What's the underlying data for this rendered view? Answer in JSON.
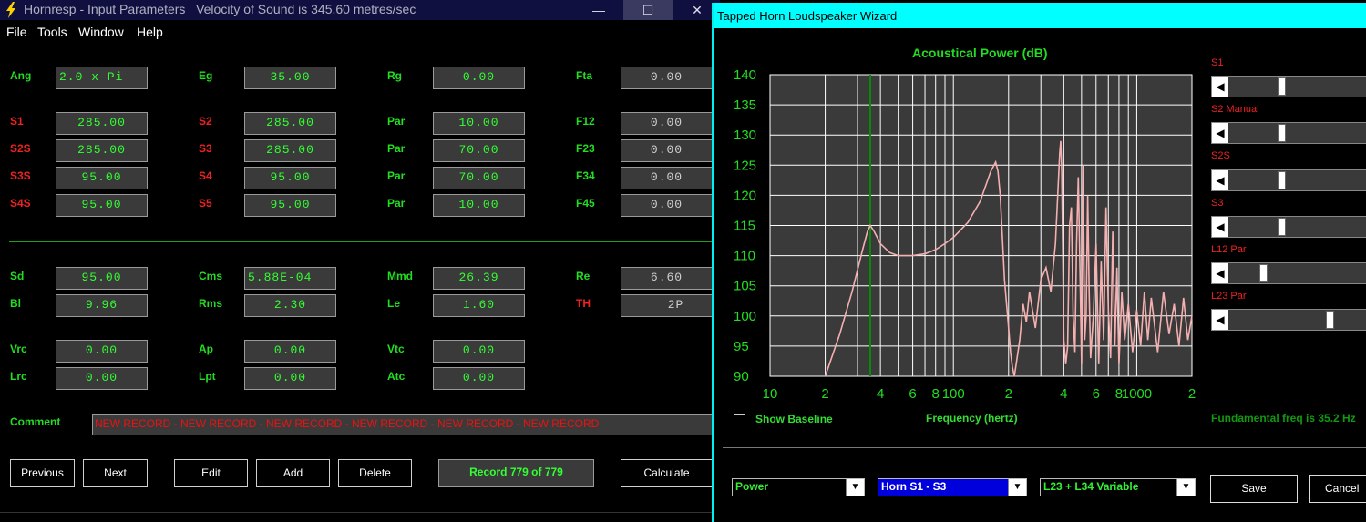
{
  "main_window": {
    "title": "Hornresp - Input Parameters   Velocity of Sound is 345.60 metres/sec",
    "controls": {
      "minimize": "—",
      "maximize": "☐",
      "close": "✕"
    },
    "menu": [
      "File",
      "Tools",
      "Window",
      "Help"
    ],
    "params": [
      {
        "label": "Ang",
        "value": "2.0 x Pi"
      },
      {
        "label": "Eg",
        "value": "35.00"
      },
      {
        "label": "Rg",
        "value": "0.00"
      },
      {
        "label": "Fta",
        "value": "0.00"
      },
      {
        "label": "S1",
        "value": "285.00"
      },
      {
        "label": "S2",
        "value": "285.00"
      },
      {
        "label": "Par",
        "value": "10.00"
      },
      {
        "label": "F12",
        "value": "0.00"
      },
      {
        "label": "S2S",
        "value": "285.00"
      },
      {
        "label": "S3",
        "value": "285.00"
      },
      {
        "label": "Par",
        "value": "70.00"
      },
      {
        "label": "F23",
        "value": "0.00"
      },
      {
        "label": "S3S",
        "value": "95.00"
      },
      {
        "label": "S4",
        "value": "95.00"
      },
      {
        "label": "Par",
        "value": "70.00"
      },
      {
        "label": "F34",
        "value": "0.00"
      },
      {
        "label": "S4S",
        "value": "95.00"
      },
      {
        "label": "S5",
        "value": "95.00"
      },
      {
        "label": "Par",
        "value": "10.00"
      },
      {
        "label": "F45",
        "value": "0.00"
      },
      {
        "label": "Sd",
        "value": "95.00"
      },
      {
        "label": "Cms",
        "value": "5.88E-04"
      },
      {
        "label": "Mmd",
        "value": "26.39"
      },
      {
        "label": "Re",
        "value": "6.60"
      },
      {
        "label": "Bl",
        "value": "9.96"
      },
      {
        "label": "Rms",
        "value": "2.30"
      },
      {
        "label": "Le",
        "value": "1.60"
      },
      {
        "label": "TH",
        "value": "2P"
      },
      {
        "label": "Vrc",
        "value": "0.00"
      },
      {
        "label": "Ap",
        "value": "0.00"
      },
      {
        "label": "Vtc",
        "value": "0.00"
      },
      {
        "label": "Lrc",
        "value": "0.00"
      },
      {
        "label": "Lpt",
        "value": "0.00"
      },
      {
        "label": "Atc",
        "value": "0.00"
      }
    ],
    "comment_label": "Comment",
    "comment_value": "NEW RECORD - NEW RECORD - NEW RECORD - NEW RECORD - NEW RECORD - NEW RECORD",
    "buttons": {
      "previous": "Previous",
      "next": "Next",
      "edit": "Edit",
      "add": "Add",
      "delete": "Delete",
      "calculate": "Calculate"
    },
    "record_status": "Record 779 of 779"
  },
  "wizard": {
    "title": "Tapped Horn Loudspeaker Wizard",
    "sliders": [
      {
        "label": "S1",
        "position": 0.38
      },
      {
        "label": "S2  Manual",
        "position": 0.38
      },
      {
        "label": "S2S",
        "position": 0.38
      },
      {
        "label": "S3",
        "position": 0.38
      },
      {
        "label": "L12  Par",
        "position": 0.24
      },
      {
        "label": "L23  Par",
        "position": 0.76
      }
    ],
    "show_baseline_label": "Show Baseline",
    "show_baseline_checked": false,
    "frequency_label": "Frequency (hertz)",
    "fundamental_label": "Fundamental freq is 35.2 Hz",
    "dropdowns": {
      "mode": "Power",
      "horn": "Horn S1 - S3",
      "variable": "L23 + L34 Variable"
    },
    "buttons": {
      "save": "Save",
      "cancel": "Cancel"
    }
  },
  "colors": {
    "accent": "#22dd22",
    "label_red": "#ee2222",
    "curve": "#f4b0b0",
    "marker": "#0a8a0a",
    "grid": "#ffffff",
    "plot_bg": "#3a3a3a",
    "wizard_title": "#00ffff"
  },
  "chart_data": {
    "type": "line",
    "title": "Acoustical Power (dB)",
    "xlabel": "Frequency (hertz)",
    "ylabel": "",
    "x_scale": "log",
    "xlim": [
      10,
      2000
    ],
    "ylim": [
      90,
      140
    ],
    "grid": true,
    "x_ticks": [
      10,
      20,
      40,
      60,
      80,
      100,
      200,
      400,
      600,
      800,
      1000,
      2000
    ],
    "x_tick_labels": [
      "10",
      "2",
      "4",
      "6",
      "8",
      "100",
      "2",
      "4",
      "6",
      "8",
      "1000",
      "2"
    ],
    "y_ticks": [
      90,
      95,
      100,
      105,
      110,
      115,
      120,
      125,
      130,
      135,
      140
    ],
    "marker_frequency": 35.2,
    "series": [
      {
        "x": [
          20,
          24,
          28,
          32,
          34,
          35.2,
          37,
          40,
          45,
          50,
          55,
          60,
          70,
          80,
          90,
          100,
          120,
          140,
          160,
          170,
          175,
          180,
          185,
          190,
          200,
          205,
          210,
          215,
          220,
          230,
          240,
          250,
          260,
          280,
          300,
          320,
          340,
          360,
          380,
          385,
          390,
          395,
          400,
          410,
          420,
          430,
          440,
          450,
          460,
          470,
          480,
          490,
          500,
          510,
          520,
          530,
          540,
          550,
          560,
          580,
          600,
          620,
          640,
          660,
          680,
          700,
          720,
          740,
          760,
          780,
          800,
          830,
          860,
          900,
          950,
          1000,
          1050,
          1100,
          1150,
          1200,
          1300,
          1400,
          1500,
          1600,
          1700,
          1800,
          1900,
          2000
        ],
        "y": [
          90,
          97,
          104,
          111,
          114,
          115,
          114,
          112,
          110.5,
          110,
          110,
          110,
          110.3,
          111,
          112,
          113,
          115.5,
          119,
          124,
          125.5,
          124,
          120,
          113,
          106,
          98,
          94,
          91.5,
          90,
          92,
          96,
          102,
          99,
          104,
          98,
          106,
          108,
          104,
          112,
          127,
          129,
          124,
          110,
          96,
          92,
          95,
          115,
          118,
          100,
          94,
          112,
          123,
          108,
          92,
          125,
          96,
          100,
          120,
          104,
          93,
          100,
          112,
          92,
          109,
          96,
          118,
          101,
          93,
          114,
          95,
          108,
          92,
          104,
          96,
          102,
          94,
          101,
          95,
          104,
          96,
          103,
          94,
          104,
          97,
          102,
          95,
          103,
          96,
          100
        ]
      }
    ]
  }
}
